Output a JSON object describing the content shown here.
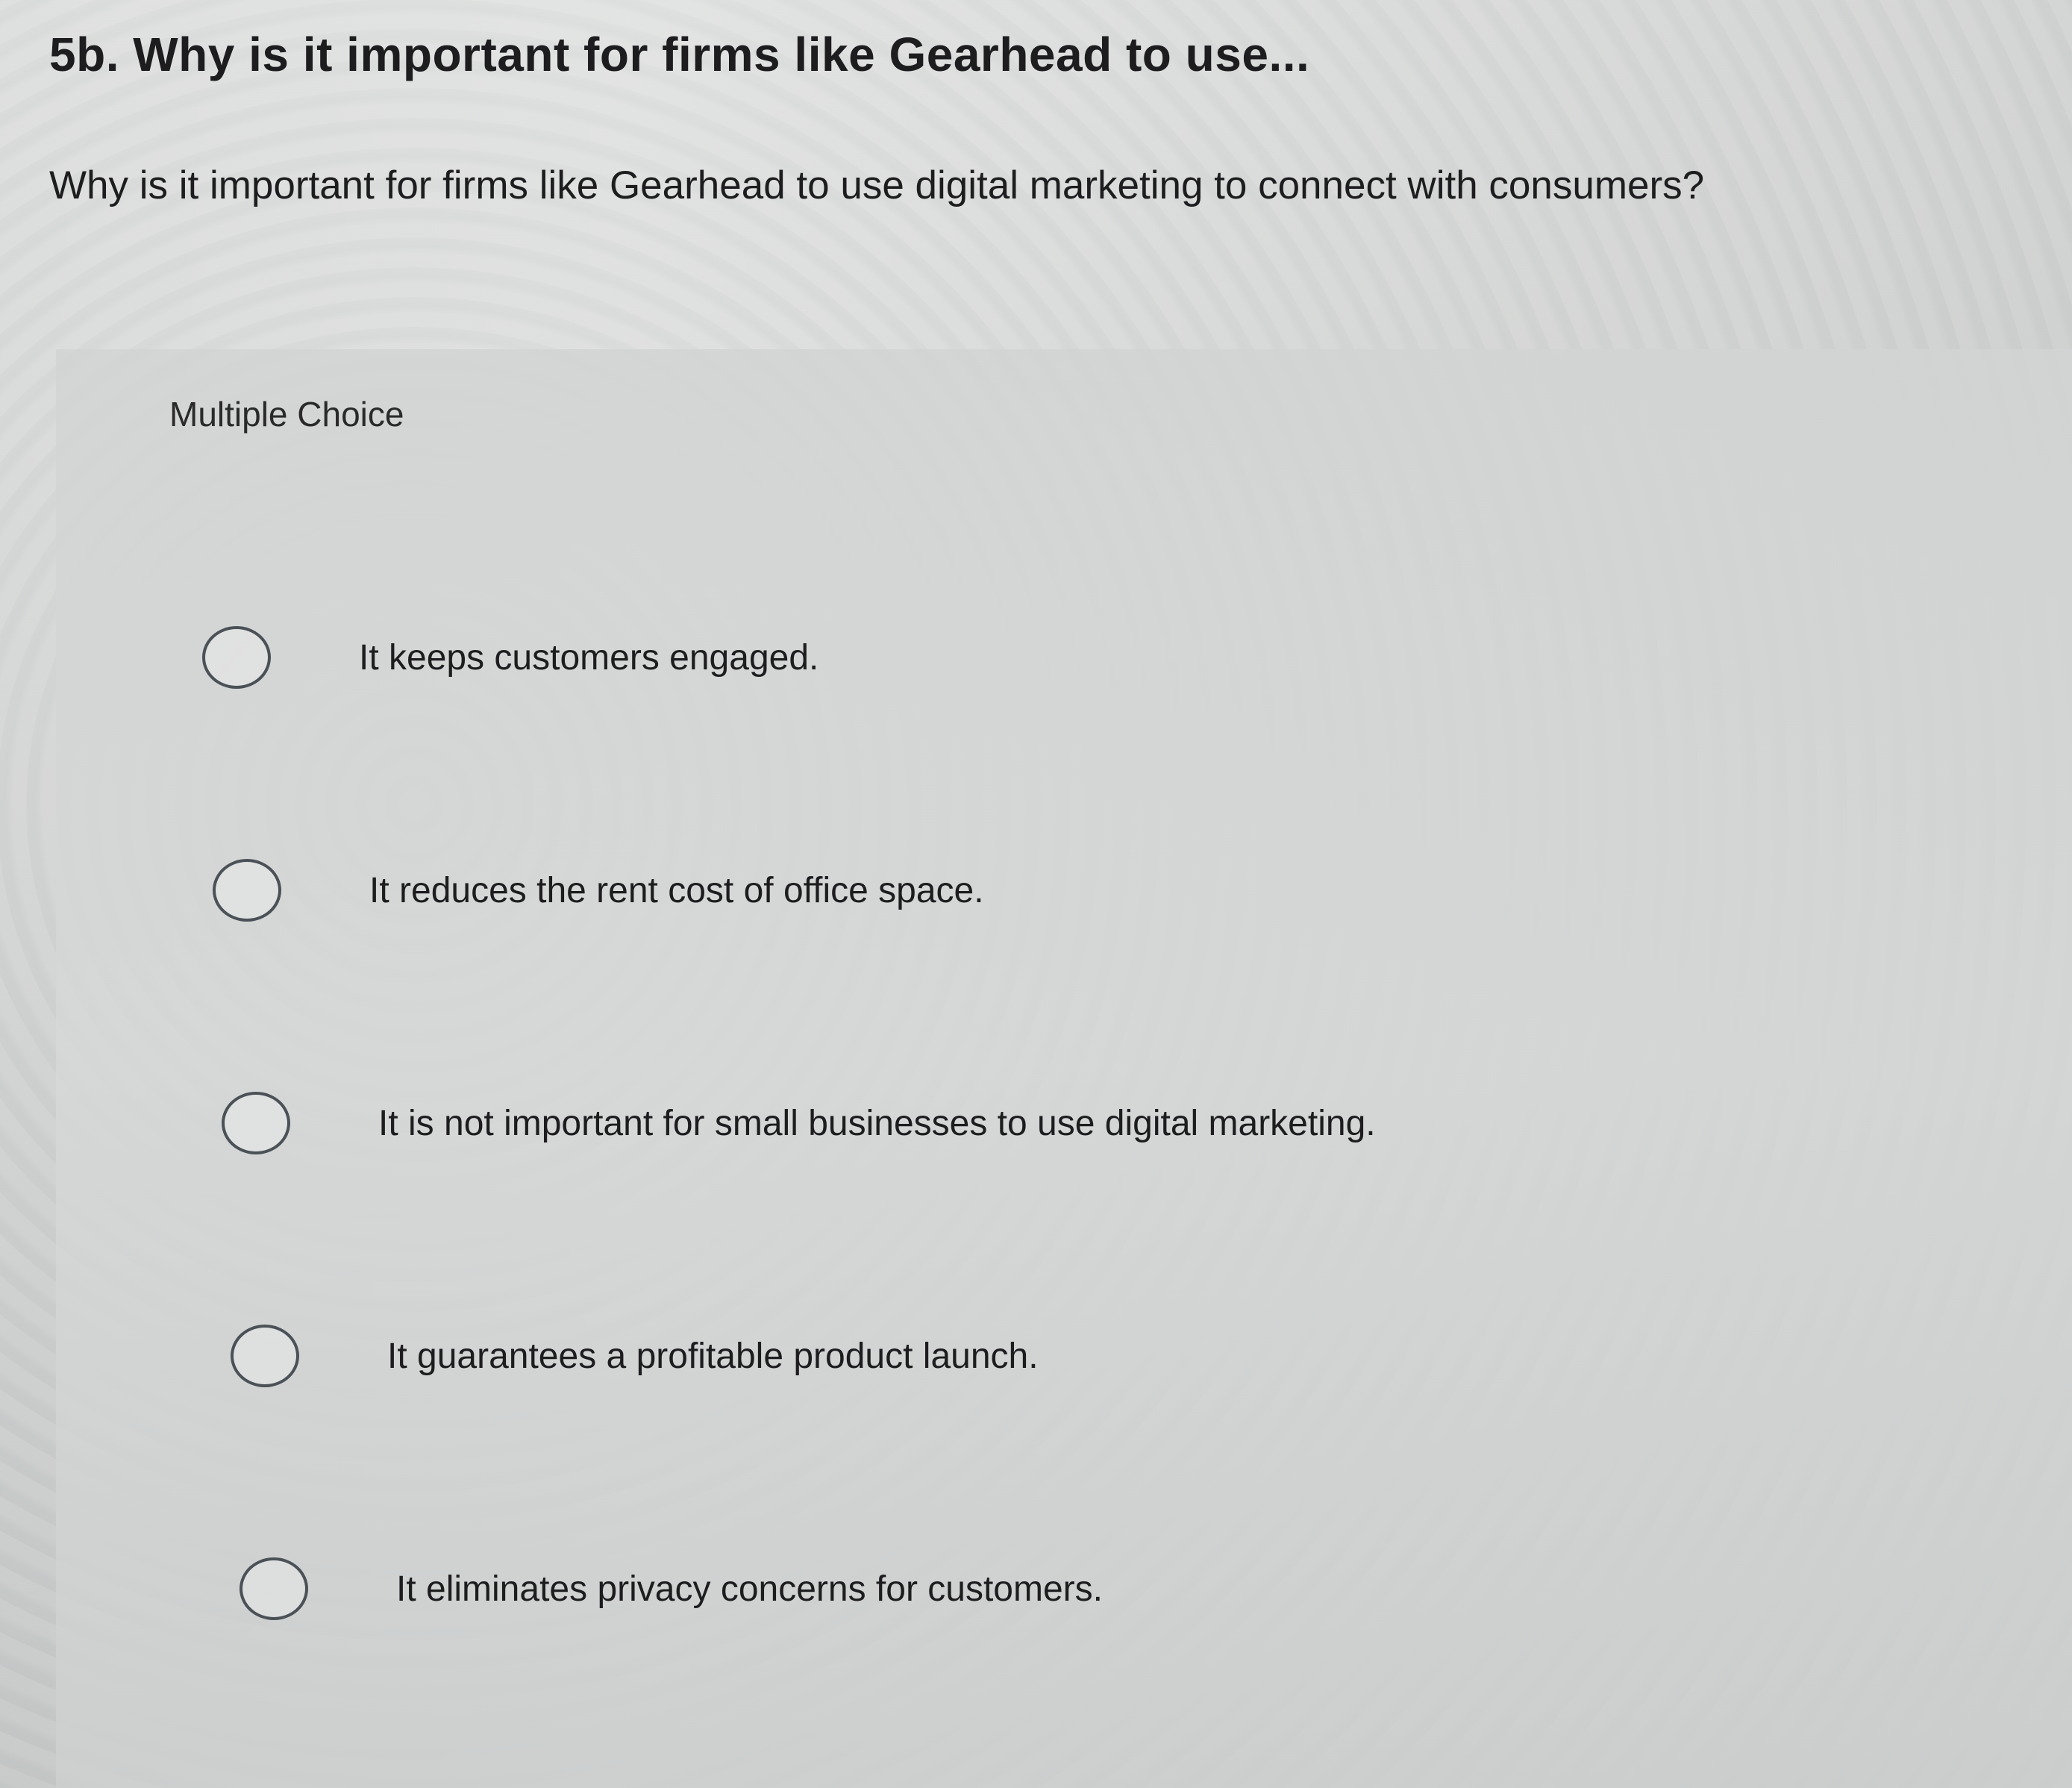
{
  "question": {
    "title": "5b. Why is it important for firms like Gearhead to use...",
    "prompt": "Why is it important for firms like Gearhead to use digital marketing to connect with consumers?",
    "type_label": "Multiple Choice",
    "options": [
      {
        "label": "It keeps customers engaged.",
        "selected": false
      },
      {
        "label": "It reduces the rent cost of office space.",
        "selected": false
      },
      {
        "label": "It is not important for small businesses to use digital marketing.",
        "selected": false
      },
      {
        "label": "It guarantees a profitable product launch.",
        "selected": false
      },
      {
        "label": "It eliminates privacy concerns for customers.",
        "selected": false
      }
    ]
  }
}
